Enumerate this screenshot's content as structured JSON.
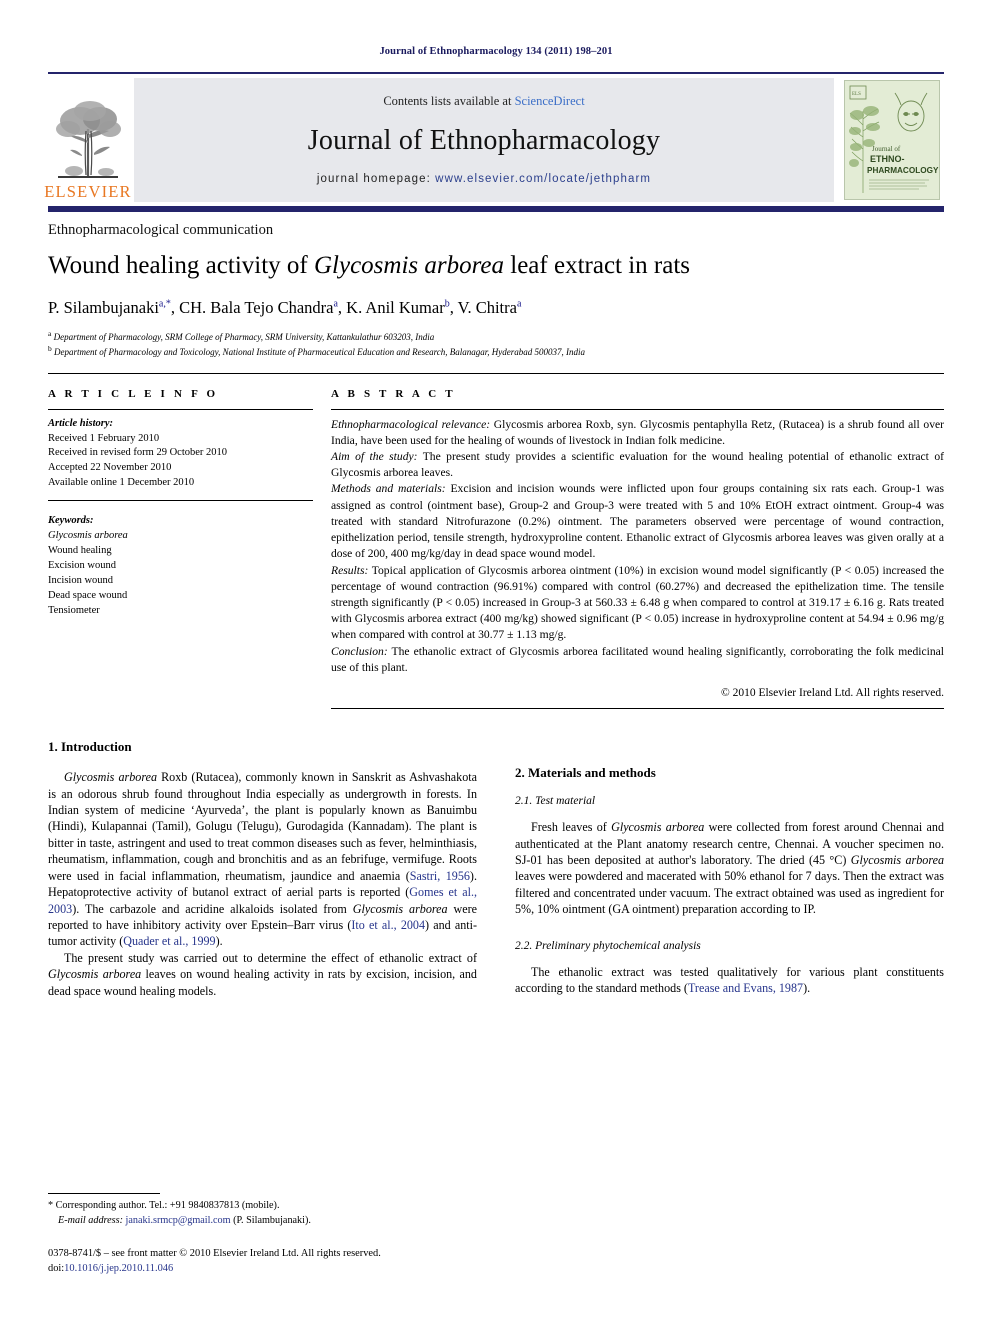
{
  "running_head": "Journal of Ethnopharmacology 134 (2011) 198–201",
  "masthead": {
    "publisher_name": "ELSEVIER",
    "contents_prefix": "Contents lists available at ",
    "contents_link": "ScienceDirect",
    "journal_title": "Journal of Ethnopharmacology",
    "homepage_prefix": "journal homepage:",
    "homepage_url": "www.elsevier.com/locate/jethpharm",
    "cover_journal_of": "Journal of",
    "cover_line1": "ETHNO-",
    "cover_line2": "PHARMACOLOGY",
    "accent_orange": "#E87722",
    "accent_navy": "#24246b",
    "band_gray": "#e7e8ec"
  },
  "article": {
    "communication_type": "Ethnopharmacological communication",
    "title_part1": "Wound healing activity of ",
    "title_italic": "Glycosmis arborea",
    "title_part2": " leaf extract in rats",
    "authors": [
      {
        "name": "P. Silambujanaki",
        "sup": "a,*"
      },
      {
        "name": "CH. Bala Tejo Chandra",
        "sup": "a"
      },
      {
        "name": "K. Anil Kumar",
        "sup": "b"
      },
      {
        "name": "V. Chitra",
        "sup": "a"
      }
    ],
    "affiliations": [
      {
        "label": "a",
        "text": "Department of Pharmacology, SRM College of Pharmacy, SRM University, Kattankulathur 603203, India"
      },
      {
        "label": "b",
        "text": "Department of Pharmacology and Toxicology, National Institute of Pharmaceutical Education and Research, Balanagar, Hyderabad 500037, India"
      }
    ]
  },
  "article_info": {
    "heading": "A R T I C L E     I N F O",
    "history_label": "Article history:",
    "history": [
      "Received 1 February 2010",
      "Received in revised form 29 October 2010",
      "Accepted 22 November 2010",
      "Available online 1 December 2010"
    ],
    "keywords_label": "Keywords:",
    "keywords": [
      "Glycosmis arborea",
      "Wound healing",
      "Excision wound",
      "Incision wound",
      "Dead space wound",
      "Tensiometer"
    ]
  },
  "abstract": {
    "heading": "A B S T R A C T",
    "relevance_label": "Ethnopharmacological relevance:",
    "relevance_text": " Glycosmis arborea Roxb, syn. Glycosmis pentaphylla Retz, (Rutacea) is a shrub found all over India, have been used for the healing of wounds of livestock in Indian folk medicine.",
    "aim_label": "Aim of the study:",
    "aim_text": " The present study provides a scientific evaluation for the wound healing potential of ethanolic extract of Glycosmis arborea leaves.",
    "methods_label": "Methods and materials:",
    "methods_text": " Excision and incision wounds were inflicted upon four groups containing six rats each. Group-1 was assigned as control (ointment base), Group-2 and Group-3 were treated with 5 and 10% EtOH extract ointment. Group-4 was treated with standard Nitrofurazone (0.2%) ointment. The parameters observed were percentage of wound contraction, epithelization period, tensile strength, hydroxyproline content. Ethanolic extract of Glycosmis arborea leaves was given orally at a dose of 200, 400 mg/kg/day in dead space wound model.",
    "results_label": "Results:",
    "results_text": " Topical application of Glycosmis arborea ointment (10%) in excision wound model significantly (P < 0.05) increased the percentage of wound contraction (96.91%) compared with control (60.27%) and decreased the epithelization time. The tensile strength significantly (P < 0.05) increased in Group-3 at 560.33 ± 6.48 g when compared to control at 319.17 ± 6.16 g. Rats treated with Glycosmis arborea extract (400 mg/kg) showed significant (P < 0.05) increase in hydroxyproline content at 54.94 ± 0.96 mg/g when compared with control at 30.77 ± 1.13 mg/g.",
    "conclusion_label": "Conclusion:",
    "conclusion_text": " The ethanolic extract of Glycosmis arborea facilitated wound healing significantly, corroborating the folk medicinal use of this plant.",
    "copyright": "© 2010 Elsevier Ireland Ltd. All rights reserved."
  },
  "body": {
    "intro_heading": "1.  Introduction",
    "intro_p1_a": "Glycosmis arborea",
    "intro_p1_b": " Roxb (Rutacea), commonly known in Sanskrit as Ashvashakota is an odorous shrub found throughout India especially as undergrowth in forests. In Indian system of medicine ‘Ayurveda’, the plant is popularly known as Banuimbu (Hindi), Kulapannai (Tamil), Golugu (Telugu), Gurodagida (Kannadam). The plant is bitter in taste, astringent and used to treat common diseases such as fever, helminthiasis, rheumatism, inflammation, cough and bronchitis and as an febrifuge, vermifuge. Roots were used in facial inflammation, rheumatism, jaundice and anaemia (",
    "intro_cite1": "Sastri, 1956",
    "intro_p1_c": "). Hepatoprotective activity of butanol extract of aerial parts is reported (",
    "intro_cite2": "Gomes et al., 2003",
    "intro_p1_d": "). The carbazole and acridine alkaloids isolated from ",
    "intro_p1_e": "Glycosmis arborea",
    "intro_p1_f": " were reported to have inhibitory activity over Epstein–Barr virus (",
    "intro_cite3": "Ito et al., 2004",
    "intro_p1_g": ") and anti-tumor activity (",
    "intro_cite4": "Quader et al., 1999",
    "intro_p1_h": ").",
    "intro_p2_a": "The present study was carried out to determine the effect of ethanolic extract of ",
    "intro_p2_b": "Glycosmis arborea",
    "intro_p2_c": " leaves on wound healing activity in rats by excision, incision, and dead space wound healing models.",
    "methods_heading": "2.  Materials and methods",
    "sub1_heading": "2.1.  Test material",
    "sub1_p_a": "Fresh leaves of ",
    "sub1_p_b": "Glycosmis arborea",
    "sub1_p_c": " were collected from forest around Chennai and authenticated at the Plant anatomy research centre, Chennai. A voucher specimen no. SJ-01 has been deposited at author's laboratory. The dried (45 °C) ",
    "sub1_p_d": "Glycosmis arborea",
    "sub1_p_e": " leaves were powdered and macerated with 50% ethanol for 7 days. Then the extract was filtered and concentrated under vacuum. The extract obtained was used as ingredient for 5%, 10% ointment (GA ointment) preparation according to IP.",
    "sub2_heading": "2.2.  Preliminary phytochemical analysis",
    "sub2_p_a": "The ethanolic extract was tested qualitatively for various plant constituents according to the standard methods (",
    "sub2_cite": "Trease and Evans, 1987",
    "sub2_p_b": ")."
  },
  "footnotes": {
    "corresponding": "* Corresponding author. Tel.: +91 9840837813 (mobile).",
    "email_label": "E-mail address:",
    "email": "janaki.srmcp@gmail.com",
    "email_suffix": " (P. Silambujanaki).",
    "issn_line": "0378-8741/$ – see front matter © 2010 Elsevier Ireland Ltd. All rights reserved.",
    "doi_label": "doi:",
    "doi": "10.1016/j.jep.2010.11.046"
  }
}
